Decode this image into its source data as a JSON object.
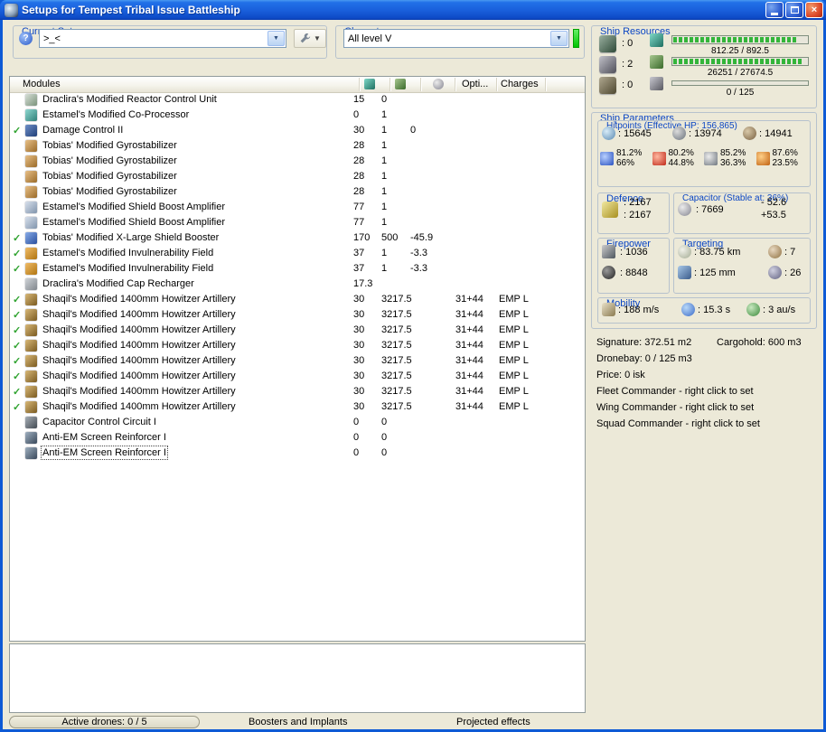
{
  "window": {
    "title": "Setups for Tempest Tribal Issue Battleship"
  },
  "current_setup": {
    "label": "Current Setup",
    "value": ">_<"
  },
  "character": {
    "label": "Character",
    "value": "All level V"
  },
  "modules": {
    "header": {
      "title": "Modules",
      "opti": "Opti...",
      "charges": "Charges"
    },
    "rows": [
      {
        "checked": false,
        "name": "Draclira's Modified Reactor Control Unit",
        "cpu": "15",
        "pg": "0",
        "cap": "",
        "opti": "",
        "charge": "",
        "ic": [
          "#d8e0d8",
          "#7a927a"
        ]
      },
      {
        "checked": false,
        "name": "Estamel's Modified Co-Processor",
        "cpu": "0",
        "pg": "1",
        "cap": "",
        "opti": "",
        "charge": "",
        "ic": [
          "#8fd8d0",
          "#2f7f78"
        ]
      },
      {
        "checked": true,
        "name": "Damage Control II",
        "cpu": "30",
        "pg": "1",
        "cap": "0",
        "opti": "",
        "charge": "",
        "ic": [
          "#6f8fc8",
          "#203f78"
        ]
      },
      {
        "checked": false,
        "name": "Tobias' Modified Gyrostabilizer",
        "cpu": "28",
        "pg": "1",
        "cap": "",
        "opti": "",
        "charge": "",
        "ic": [
          "#e8c088",
          "#9a6a28"
        ]
      },
      {
        "checked": false,
        "name": "Tobias' Modified Gyrostabilizer",
        "cpu": "28",
        "pg": "1",
        "cap": "",
        "opti": "",
        "charge": "",
        "ic": [
          "#e8c088",
          "#9a6a28"
        ]
      },
      {
        "checked": false,
        "name": "Tobias' Modified Gyrostabilizer",
        "cpu": "28",
        "pg": "1",
        "cap": "",
        "opti": "",
        "charge": "",
        "ic": [
          "#e8c088",
          "#9a6a28"
        ]
      },
      {
        "checked": false,
        "name": "Tobias' Modified Gyrostabilizer",
        "cpu": "28",
        "pg": "1",
        "cap": "",
        "opti": "",
        "charge": "",
        "ic": [
          "#e8c088",
          "#9a6a28"
        ]
      },
      {
        "checked": false,
        "name": "Estamel's Modified Shield Boost Amplifier",
        "cpu": "77",
        "pg": "1",
        "cap": "",
        "opti": "",
        "charge": "",
        "ic": [
          "#d8e0ec",
          "#8094ac"
        ]
      },
      {
        "checked": false,
        "name": "Estamel's Modified Shield Boost Amplifier",
        "cpu": "77",
        "pg": "1",
        "cap": "",
        "opti": "",
        "charge": "",
        "ic": [
          "#d8e0ec",
          "#8094ac"
        ]
      },
      {
        "checked": true,
        "name": "Tobias' Modified X-Large Shield Booster",
        "cpu": "170",
        "pg": "500",
        "cap": "-45.9",
        "opti": "",
        "charge": "",
        "ic": [
          "#88ace8",
          "#2a4f9e"
        ]
      },
      {
        "checked": true,
        "name": "Estamel's Modified Invulnerability Field",
        "cpu": "37",
        "pg": "1",
        "cap": "-3.3",
        "opti": "",
        "charge": "",
        "ic": [
          "#f0bc68",
          "#b07410"
        ]
      },
      {
        "checked": true,
        "name": "Estamel's Modified Invulnerability Field",
        "cpu": "37",
        "pg": "1",
        "cap": "-3.3",
        "opti": "",
        "charge": "",
        "ic": [
          "#f0bc68",
          "#b07410"
        ]
      },
      {
        "checked": false,
        "name": "Draclira's Modified Cap Recharger",
        "cpu": "17.3",
        "pg": "",
        "cap": "",
        "opti": "",
        "charge": "",
        "ic": [
          "#d0d4d8",
          "#80868c"
        ]
      },
      {
        "checked": true,
        "name": "Shaqil's Modified 1400mm Howitzer Artillery",
        "cpu": "30",
        "pg": "3217.5",
        "cap": "",
        "opti": "31+44",
        "charge": "EMP L",
        "ic": [
          "#d8b878",
          "#7a5a20"
        ]
      },
      {
        "checked": true,
        "name": "Shaqil's Modified 1400mm Howitzer Artillery",
        "cpu": "30",
        "pg": "3217.5",
        "cap": "",
        "opti": "31+44",
        "charge": "EMP L",
        "ic": [
          "#d8b878",
          "#7a5a20"
        ]
      },
      {
        "checked": true,
        "name": "Shaqil's Modified 1400mm Howitzer Artillery",
        "cpu": "30",
        "pg": "3217.5",
        "cap": "",
        "opti": "31+44",
        "charge": "EMP L",
        "ic": [
          "#d8b878",
          "#7a5a20"
        ]
      },
      {
        "checked": true,
        "name": "Shaqil's Modified 1400mm Howitzer Artillery",
        "cpu": "30",
        "pg": "3217.5",
        "cap": "",
        "opti": "31+44",
        "charge": "EMP L",
        "ic": [
          "#d8b878",
          "#7a5a20"
        ]
      },
      {
        "checked": true,
        "name": "Shaqil's Modified 1400mm Howitzer Artillery",
        "cpu": "30",
        "pg": "3217.5",
        "cap": "",
        "opti": "31+44",
        "charge": "EMP L",
        "ic": [
          "#d8b878",
          "#7a5a20"
        ]
      },
      {
        "checked": true,
        "name": "Shaqil's Modified 1400mm Howitzer Artillery",
        "cpu": "30",
        "pg": "3217.5",
        "cap": "",
        "opti": "31+44",
        "charge": "EMP L",
        "ic": [
          "#d8b878",
          "#7a5a20"
        ]
      },
      {
        "checked": true,
        "name": "Shaqil's Modified 1400mm Howitzer Artillery",
        "cpu": "30",
        "pg": "3217.5",
        "cap": "",
        "opti": "31+44",
        "charge": "EMP L",
        "ic": [
          "#d8b878",
          "#7a5a20"
        ]
      },
      {
        "checked": true,
        "name": "Shaqil's Modified 1400mm Howitzer Artillery",
        "cpu": "30",
        "pg": "3217.5",
        "cap": "",
        "opti": "31+44",
        "charge": "EMP L",
        "ic": [
          "#d8b878",
          "#7a5a20"
        ]
      },
      {
        "checked": false,
        "name": "Capacitor Control Circuit I",
        "cpu": "0",
        "pg": "0",
        "cap": "",
        "opti": "",
        "charge": "",
        "ic": [
          "#a8b0b8",
          "#434a52"
        ]
      },
      {
        "checked": false,
        "name": "Anti-EM Screen Reinforcer I",
        "cpu": "0",
        "pg": "0",
        "cap": "",
        "opti": "",
        "charge": "",
        "ic": [
          "#a0b0c0",
          "#39485a"
        ]
      },
      {
        "checked": false,
        "name": "Anti-EM Screen Reinforcer I",
        "cpu": "0",
        "pg": "0",
        "cap": "",
        "opti": "",
        "charge": "",
        "focused": true,
        "ic": [
          "#a0b0c0",
          "#39485a"
        ]
      }
    ]
  },
  "bottom": {
    "active_drones": "Active drones: 0 / 5",
    "boosters": "Boosters and Implants",
    "projected": "Projected effects"
  },
  "ship_resources": {
    "label": "Ship Resources",
    "slots": [
      {
        "type": "turret",
        "icon": "turret-hardpoints-icon",
        "value": ": 0"
      },
      {
        "type": "launcher",
        "icon": "launcher-hardpoints-icon",
        "value": ": 2"
      },
      {
        "type": "rigslot",
        "icon": "rig-slots-icon",
        "value": ": 0"
      }
    ],
    "cpu": {
      "text": "812.25 / 892.5",
      "pct": 91
    },
    "powergrid": {
      "text": "26251 / 27674.5",
      "pct": 95
    },
    "dronebay": {
      "text": "0 / 125",
      "pct": 0
    },
    "bar_color": "#33b53a"
  },
  "ship_parameters": {
    "label": "Ship Parameters",
    "hitpoints": {
      "label": "Hitpoints (Effective HP: 156,865)",
      "shield": ": 15645",
      "armor": ": 13974",
      "structure": ": 14941",
      "resists": [
        {
          "type": "em",
          "shield": "81.2%",
          "armor": "66%"
        },
        {
          "type": "thermal",
          "shield": "80.2%",
          "armor": "44.8%"
        },
        {
          "type": "kinetic",
          "shield": "85.2%",
          "armor": "36.3%"
        },
        {
          "type": "explosive",
          "shield": "87.6%",
          "armor": "23.5%"
        }
      ]
    },
    "defence": {
      "label": "Defence",
      "v1": ": 2167",
      "v2": ": 2167"
    },
    "capacitor": {
      "label": "Capacitor (Stable at: 36%)",
      "amount": ": 7669",
      "drain": "- 52.6",
      "recharge": "+53.5"
    },
    "firepower": {
      "label": "Firepower",
      "dps": ": 1036",
      "volley": ": 8848"
    },
    "targeting": {
      "label": "Targeting",
      "range": ": 83.75 km",
      "max_targets": ": 7",
      "scan_res": ": 125 mm",
      "sensor_str": ": 26"
    },
    "mobility": {
      "label": "Mobility",
      "speed": ": 188 m/s",
      "align": ": 15.3 s",
      "warp": ": 3 au/s"
    }
  },
  "info": {
    "signature": "Signature: 372.51 m2",
    "cargohold": "Cargohold: 600 m3",
    "dronebay": "Dronebay: 0 / 125 m3",
    "price": "Price: 0 isk",
    "fleet": "Fleet Commander - right click to set",
    "wing": "Wing Commander - right click to set",
    "squad": "Squad Commander - right click to set"
  }
}
